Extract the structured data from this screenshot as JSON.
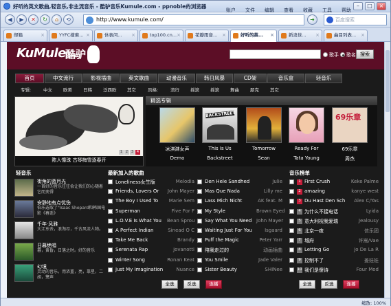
{
  "window": {
    "title": "好听的英文歌曲,轻音乐,非主流音乐 - 酷驴音乐Kumule.com - ppnoble的浏览器",
    "menus": [
      "账户",
      "文件",
      "编辑",
      "查看",
      "收藏",
      "工具",
      "帮助"
    ],
    "address": "http://www.kumule.com/",
    "search_placeholder": "百度搜索",
    "zoom": "缩放: 100%"
  },
  "tabs": [
    {
      "label": "邮箱"
    },
    {
      "label": "YYFC搜索..."
    },
    {
      "label": "休表问..."
    },
    {
      "label": "top100.cn..."
    },
    {
      "label": "花瓣雨音..."
    },
    {
      "label": "好听的英..."
    },
    {
      "label": "新浪世..."
    },
    {
      "label": "曲目列表..."
    }
  ],
  "site": {
    "logo": "KuMule",
    "logo_sub": ".com",
    "logo_cn": "酷驴",
    "radio_song": "歌手",
    "radio_name": "歌名",
    "search_button": "搜索",
    "nav": [
      "首页",
      "中文流行",
      "影视插曲",
      "英文歌曲",
      "动漫音乐",
      "韩日风暴",
      "CD架",
      "音乐盒",
      "轻音乐"
    ],
    "sub_album_label": "专辑:",
    "sub_albums": [
      "中文",
      "欧美",
      "日韩",
      "泛西欧",
      "其它"
    ],
    "sub_style_label": "风格:",
    "sub_styles": [
      "流行",
      "摇滚",
      "摇滚",
      "舞曲",
      "朋克",
      "其它"
    ],
    "banner_caption": "陈人憧珠 古琴梅雪逐春开",
    "banner_pages": [
      "1",
      "2",
      "3",
      "4"
    ]
  },
  "featured": {
    "title": "精选专辑",
    "albums": [
      {
        "title": "冰淇淋女声",
        "artist": "Demo"
      },
      {
        "title": "This Is Us",
        "artist": "Backstreet"
      },
      {
        "title": "Tomorrow",
        "artist": "Sean"
      },
      {
        "title": "Ready For",
        "artist": "Tata Young"
      },
      {
        "title": "69乐章",
        "artist": "周杰"
      }
    ],
    "covers": {
      "backstreet_text": "BACKSTREET"
    }
  },
  "left": {
    "title": "轻音乐",
    "items": [
      {
        "title": "街角的蓝月光",
        "desc": "一首好的音乐往往会让我们的心随着它而变得"
      },
      {
        "title": "安静地有点忧伤",
        "desc": "伯乐选取了\"Isaac Shepard和韩国电影《春逝》"
      },
      {
        "title": "千年·风雅",
        "desc": "大江东去，浪淘尽，千古风流人物。"
      },
      {
        "title": "日暮绝唱",
        "desc": "暮，黄昏，日落之时。好的音乐"
      },
      {
        "title": "幻境",
        "desc": "灵动的音乐，用浓重，亮，靠星，二胡，箫声"
      }
    ]
  },
  "latest": {
    "title": "最新加入的歌曲",
    "col1": [
      {
        "title": "Loneliness女生版",
        "artist": "Melodia"
      },
      {
        "title": "Friends, Lovers Or",
        "artist": "John Mayer"
      },
      {
        "title": "The Boy I Used To",
        "artist": "Marie Sem"
      },
      {
        "title": "Superman",
        "artist": "Five For F"
      },
      {
        "title": "L.O.V.E Is What You",
        "artist": "Bean Sprou"
      },
      {
        "title": "A Perfect Indian",
        "artist": "Sinead O C"
      },
      {
        "title": "Take Me Back",
        "artist": "Brandy"
      },
      {
        "title": "Serenata Rap",
        "artist": "Jovanotti"
      },
      {
        "title": "Winter Song",
        "artist": "Ronan Keat"
      },
      {
        "title": "Just My Imagination",
        "artist": "Nuance"
      }
    ],
    "col2": [
      {
        "title": "Den Hele Sandhed",
        "artist": "Julie"
      },
      {
        "title": "Mas Que Nada",
        "artist": "Lilly me"
      },
      {
        "title": "Lass Mich Nicht",
        "artist": "AK feat. M"
      },
      {
        "title": "My Style",
        "artist": "Brown Eyed"
      },
      {
        "title": "Say What You Need",
        "artist": "John Mayer"
      },
      {
        "title": "Waiting Just For You",
        "artist": "Isgaard"
      },
      {
        "title": "Puff the Magic",
        "artist": "Peter Yarr"
      },
      {
        "title": "陪我走过的",
        "artist": "动画插曲"
      },
      {
        "title": "You Smile",
        "artist": "Jade Valer"
      },
      {
        "title": "Sister Beauty",
        "artist": "SHINee"
      }
    ],
    "buttons": {
      "select_all": "全选",
      "invert": "反选",
      "play": "连播"
    }
  },
  "chart": {
    "title": "音乐榜单",
    "items": [
      {
        "rank": "1",
        "title": "First Crush",
        "artist": "Keke Palme"
      },
      {
        "rank": "2",
        "title": "amazing",
        "artist": "kanye west"
      },
      {
        "rank": "3",
        "title": "Du Hast Den Sch",
        "artist": "Alex C/Yas"
      },
      {
        "rank": "4",
        "title": "为什么不接电话",
        "artist": "Lyida"
      },
      {
        "rank": "5",
        "title": "意大利祝我爱瑞",
        "artist": "Jealousy"
      },
      {
        "rank": "6",
        "title": "北京一夜",
        "artist": "信乐团"
      },
      {
        "rank": "7",
        "title": "城府",
        "artist": "许嵩/Vae"
      },
      {
        "rank": "8",
        "title": "Letting Go",
        "artist": "Jo De La R"
      },
      {
        "rank": "9",
        "title": "控制不了",
        "artist": "姜娃娃"
      },
      {
        "rank": "10",
        "title": "我们是傻诗",
        "artist": "Four Mod"
      }
    ],
    "buttons": {
      "select_all": "全选",
      "invert": "反选",
      "play": "连播"
    }
  }
}
